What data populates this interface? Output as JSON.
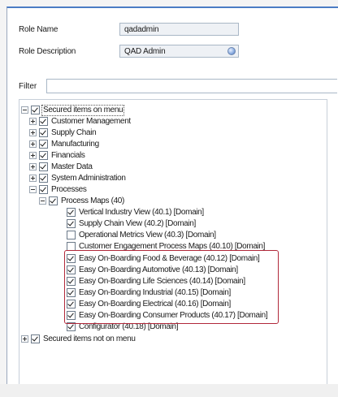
{
  "form": {
    "role_name_label": "Role Name",
    "role_name_value": "qadadmin",
    "role_description_label": "Role Description",
    "role_description_value": "QAD Admin",
    "filter_label": "Filter",
    "filter_value": ""
  },
  "tree": {
    "secured_on_menu": "Secured items on menu",
    "customer_management": "Customer Management",
    "supply_chain": "Supply Chain",
    "manufacturing": "Manufacturing",
    "financials": "Financials",
    "master_data": "Master Data",
    "system_administration": "System Administration",
    "processes": "Processes",
    "process_maps": "Process Maps (40)",
    "vertical_industry": "Vertical Industry View (40.1) [Domain]",
    "supply_chain_view": "Supply Chain View (40.2) [Domain]",
    "operational_metrics": "Operational Metrics View (40.3) [Domain]",
    "customer_engagement": "Customer Engagement Process Maps (40.10) [Domain]",
    "food_beverage": "Easy On-Boarding Food & Beverage (40.12) [Domain]",
    "automotive": "Easy On-Boarding Automotive (40.13) [Domain]",
    "life_sciences": "Easy On-Boarding Life Sciences (40.14) [Domain]",
    "industrial": "Easy On-Boarding Industrial (40.15) [Domain]",
    "electrical": "Easy On-Boarding Electrical (40.16) [Domain]",
    "consumer_products": "Easy On-Boarding Consumer Products (40.17) [Domain]",
    "configurator": "Configurator (40.18) [Domain]",
    "secured_not_on_menu": "Secured items not on menu"
  },
  "colors": {
    "highlight_border": "#b1283a",
    "window_accent": "#4b7cc4"
  }
}
